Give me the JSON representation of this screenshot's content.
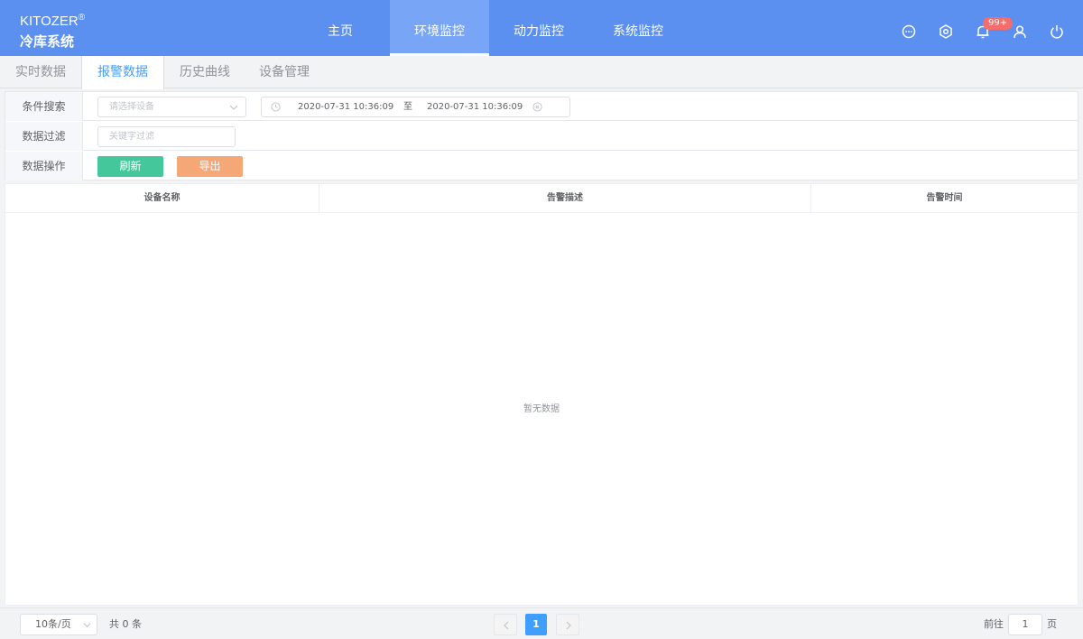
{
  "brand": {
    "name": "KITOZER",
    "mark": "®",
    "system": "冷库系统"
  },
  "nav": [
    {
      "label": "主页"
    },
    {
      "label": "环境监控"
    },
    {
      "label": "动力监控"
    },
    {
      "label": "系统监控"
    }
  ],
  "nav_active": "环境监控",
  "header_icons": [
    "message-icon",
    "settings-icon",
    "bell-icon",
    "user-icon",
    "power-icon"
  ],
  "notification_badge": "99+",
  "tabs": [
    {
      "label": "实时数据"
    },
    {
      "label": "报警数据"
    },
    {
      "label": "历史曲线"
    },
    {
      "label": "设备管理"
    }
  ],
  "tab_active": "报警数据",
  "filter": {
    "search_label": "条件搜索",
    "device_placeholder": "请选择设备",
    "date_start": "2020-07-31 10:36:09",
    "date_separator": "至",
    "date_end": "2020-07-31 10:36:09",
    "filter_label": "数据过滤",
    "keyword_placeholder": "关键字过滤",
    "ops_label": "数据操作",
    "refresh_label": "刷新",
    "export_label": "导出"
  },
  "table": {
    "columns": [
      "设备名称",
      "告警描述",
      "告警时间"
    ],
    "empty_text": "暂无数据"
  },
  "pagination": {
    "page_size": "10条/页",
    "total": "共 0 条",
    "current_page": "1",
    "goto_label": "前往",
    "goto_value": "1",
    "page_suffix": "页"
  },
  "colors": {
    "header": "#5b8ff0",
    "nav_active": "#78a5f6",
    "primary": "#409eff",
    "refresh": "#44c89b",
    "export": "#f5a876",
    "badge": "#f56c6c"
  }
}
